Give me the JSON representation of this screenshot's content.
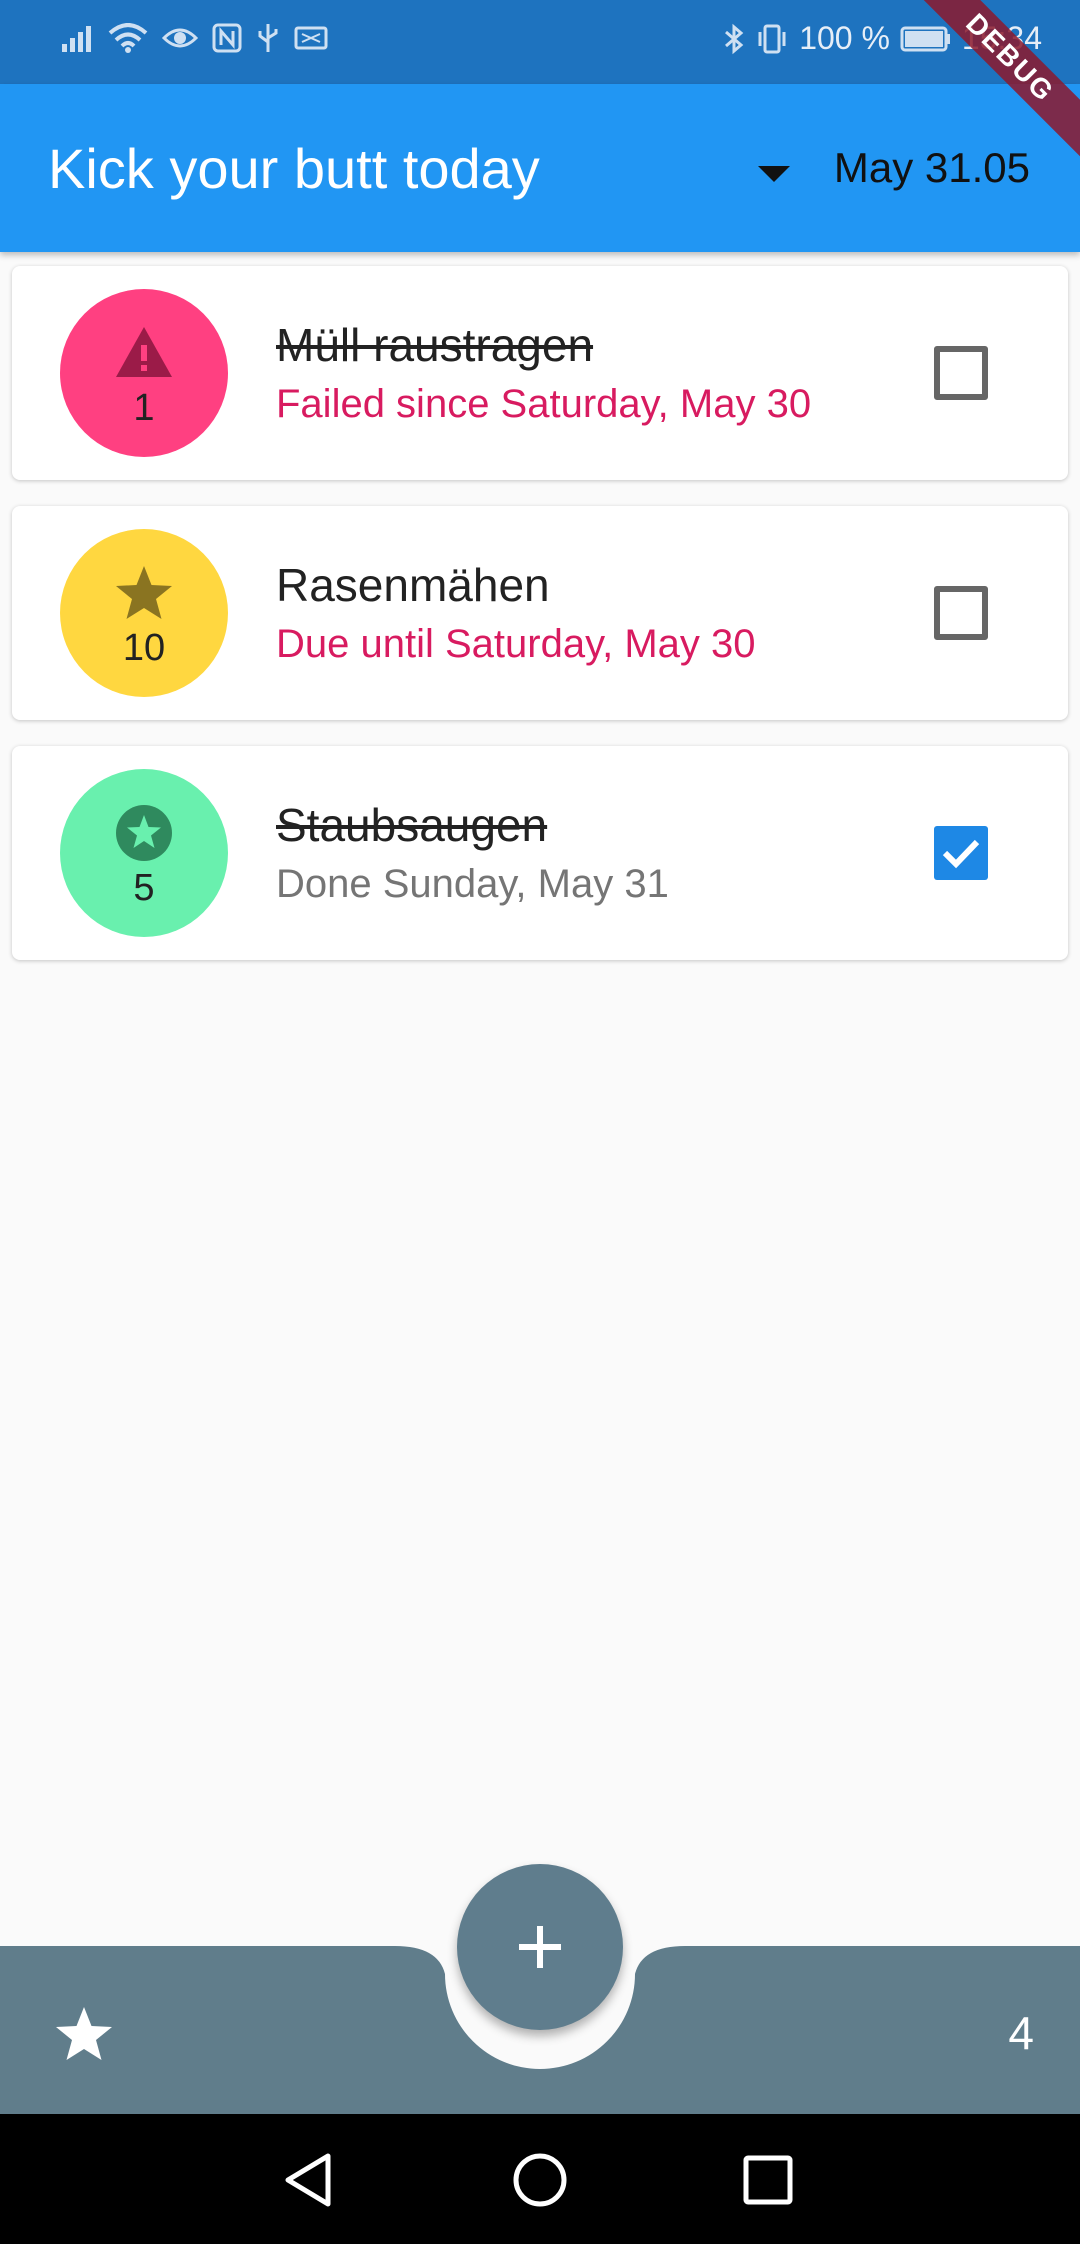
{
  "status_bar": {
    "battery_percent": "100 %",
    "time": "15:34",
    "debug_label": "DEBUG",
    "left_icons": [
      "signal-icon",
      "wifi-icon",
      "eye-icon",
      "nfc-icon",
      "usb-icon",
      "message-icon"
    ],
    "right_icons": [
      "bluetooth-icon",
      "vibrate-icon",
      "battery-icon"
    ]
  },
  "app_bar": {
    "title": "Kick your butt today",
    "date": "May 31.05",
    "background_color": "#2196f3"
  },
  "tasks": [
    {
      "title": "Müll raustragen",
      "subtitle": "Failed since Saturday, May 30",
      "points": "1",
      "icon": "warning-icon",
      "avatar_color": "#ff4081",
      "title_struck": true,
      "subtitle_color": "#d81b60",
      "checked": false
    },
    {
      "title": "Rasenmähen",
      "subtitle": "Due until Saturday, May 30",
      "points": "10",
      "icon": "star-icon",
      "avatar_color": "#ffd740",
      "title_struck": false,
      "subtitle_color": "#d81b60",
      "checked": false
    },
    {
      "title": "Staubsaugen",
      "subtitle": "Done Sunday, May 31",
      "points": "5",
      "icon": "star-circle-icon",
      "avatar_color": "#69f0ae",
      "title_struck": true,
      "subtitle_color": "#757575",
      "checked": true
    }
  ],
  "bottom_bar": {
    "score": "4",
    "bar_color": "#607d8b",
    "left_icon": "star-icon",
    "fab_icon": "add-icon"
  },
  "nav_bar": {
    "buttons": [
      "back-icon",
      "home-icon",
      "recents-icon"
    ]
  }
}
